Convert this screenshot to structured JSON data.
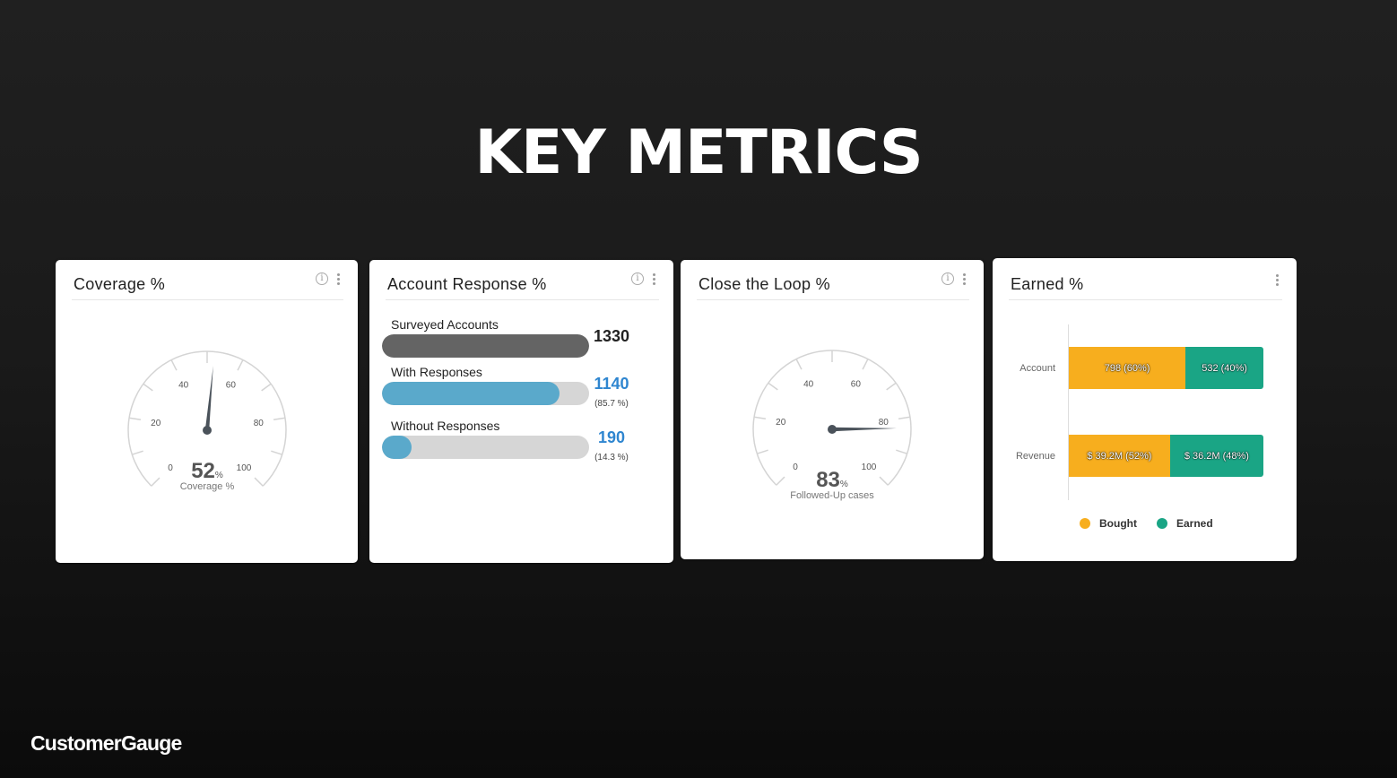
{
  "page": {
    "title": "KEY METRICS",
    "logo": "CustomerGauge"
  },
  "cards": {
    "coverage": {
      "title": "Coverage %",
      "has_info": true,
      "gauge": {
        "value": 52,
        "value_label": "52",
        "unit": "%",
        "caption": "Coverage %",
        "min": 0,
        "max": 100,
        "tick_labels": [
          "0",
          "20",
          "40",
          "60",
          "80",
          "100"
        ]
      }
    },
    "account_response": {
      "title": "Account Response %",
      "has_info": true,
      "rows": [
        {
          "label": "Surveyed Accounts",
          "value": "1330",
          "percent_text": "",
          "fraction": 1.0,
          "color": "#646464",
          "value_color": "#222222"
        },
        {
          "label": "With Responses",
          "value": "1140",
          "percent_text": "(85.7 %)",
          "fraction": 0.857,
          "color": "#5aa9cb",
          "value_color": "#2f86d0"
        },
        {
          "label": "Without Responses",
          "value": "190",
          "percent_text": "(14.3 %)",
          "fraction": 0.143,
          "color": "#5aa9cb",
          "value_color": "#2f86d0"
        }
      ]
    },
    "close_the_loop": {
      "title": "Close the Loop %",
      "has_info": true,
      "gauge": {
        "value": 83,
        "value_label": "83",
        "unit": "%",
        "caption": "Followed-Up cases",
        "min": 0,
        "max": 100,
        "tick_labels": [
          "0",
          "20",
          "40",
          "60",
          "80",
          "100"
        ]
      }
    },
    "earned": {
      "title": "Earned %",
      "has_info": false
    }
  },
  "colors": {
    "bought": "#f7ae1e",
    "earned": "#1aa585",
    "gauge_needle": "#4a525a",
    "gauge_arc": "#d4d4d4"
  },
  "chart_data": {
    "type": "bar",
    "orientation": "horizontal",
    "stacked": true,
    "title": "Earned %",
    "categories": [
      "Account",
      "Revenue"
    ],
    "series": [
      {
        "name": "Bought",
        "values": [
          798,
          39.2
        ],
        "labels": [
          "798 (60%)",
          "$ 39.2M (52%)"
        ],
        "percent": [
          60,
          52
        ]
      },
      {
        "name": "Earned",
        "values": [
          532,
          36.2
        ],
        "labels": [
          "532 (40%)",
          "$ 36.2M (48%)"
        ],
        "percent": [
          40,
          48
        ]
      }
    ],
    "legend": [
      "Bought",
      "Earned"
    ],
    "legend_position": "bottom",
    "grid": false
  }
}
